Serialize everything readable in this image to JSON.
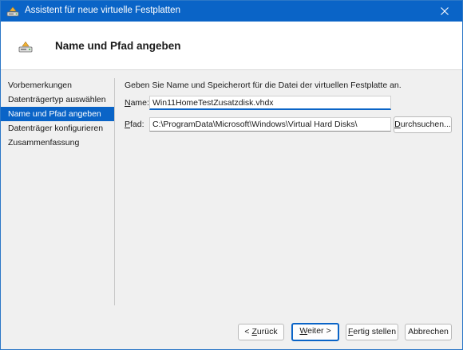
{
  "window": {
    "title": "Assistent für neue virtuelle Festplatten",
    "accent": "#0a64c7"
  },
  "header": {
    "title": "Name und Pfad angeben",
    "icon": "virtual-disk-icon"
  },
  "nav": {
    "items": [
      {
        "label": "Vorbemerkungen",
        "active": false
      },
      {
        "label": "Datenträgertyp auswählen",
        "active": false
      },
      {
        "label": "Name und Pfad angeben",
        "active": true
      },
      {
        "label": "Datenträger konfigurieren",
        "active": false
      },
      {
        "label": "Zusammenfassung",
        "active": false
      }
    ]
  },
  "form": {
    "intro": "Geben Sie Name und Speicherort für die Datei der virtuellen Festplatte an.",
    "name_label_accel": "N",
    "name_label_rest": "ame:",
    "name_value": "Win11HomeTestZusatzdisk.vhdx",
    "path_label_accel": "P",
    "path_label_rest": "fad:",
    "path_value": "C:\\ProgramData\\Microsoft\\Windows\\Virtual Hard Disks\\",
    "browse_accel": "D",
    "browse_rest": "urchsuchen..."
  },
  "footer": {
    "back_accel": "Z",
    "back_pre": "< ",
    "back_rest": "urück",
    "next_accel": "W",
    "next_rest": "eiter >",
    "finish_accel": "F",
    "finish_rest": "ertig stellen",
    "cancel": "Abbrechen"
  }
}
